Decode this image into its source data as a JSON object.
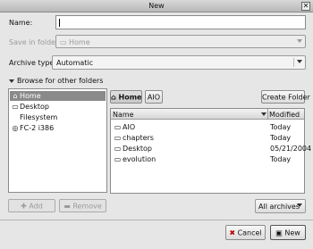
{
  "window": {
    "title": "New",
    "close_glyph": "✕"
  },
  "form": {
    "name_label": "Name:",
    "name_value": "",
    "save_in_label": "Save in folder:",
    "save_in_value": "Home",
    "archive_type_label": "Archive type:",
    "archive_type_value": "Automatic"
  },
  "browse": {
    "label": "Browse for other folders"
  },
  "places": [
    {
      "label": "Home",
      "icon": "home-icon",
      "glyph": "⌂",
      "selected": true
    },
    {
      "label": "Desktop",
      "icon": "desktop-icon",
      "glyph": "▭",
      "selected": false
    },
    {
      "label": "Filesystem",
      "icon": "",
      "glyph": "",
      "selected": false
    },
    {
      "label": "FC-2 i386",
      "icon": "disc-icon",
      "glyph": "◎",
      "selected": false
    }
  ],
  "path_bar": {
    "home": "Home",
    "aio": "AIO"
  },
  "create_folder": "Create Folder",
  "files": {
    "col_name": "Name",
    "col_modified": "Modified",
    "rows": [
      {
        "name": "AIO",
        "modified": "Today",
        "glyph": "▭"
      },
      {
        "name": "chapters",
        "modified": "Today",
        "glyph": "▭"
      },
      {
        "name": "Desktop",
        "modified": "05/21/2004",
        "glyph": "▭"
      },
      {
        "name": "evolution",
        "modified": "Today",
        "glyph": "▭"
      }
    ]
  },
  "place_buttons": {
    "add": "Add",
    "remove": "Remove"
  },
  "filter": {
    "value": "All archives"
  },
  "actions": {
    "cancel": "Cancel",
    "new": "New"
  }
}
